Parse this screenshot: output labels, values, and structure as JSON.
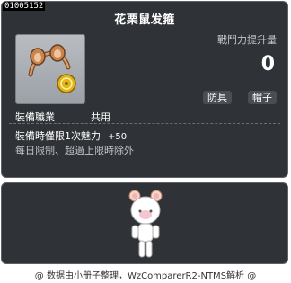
{
  "item": {
    "id": "01005152",
    "name": "花栗鼠发箍"
  },
  "stats": {
    "label": "戰鬥力提升量",
    "value": "0"
  },
  "tags": {
    "type": "防具",
    "subtype": "帽子"
  },
  "job": {
    "label": "裝備職業",
    "value": "共用"
  },
  "effects": {
    "line": "裝備時僅限1次魅力",
    "bonus": "+50",
    "limit": "每日限制、超過上限時除外"
  },
  "footer": {
    "text": "@ 数据由小册子整理，WzComparerR2-NTMS解析 @"
  },
  "colors": {
    "panel": "#2f3236",
    "border": "#5e6268",
    "icon_bg": "#b9bdc2"
  },
  "icons": {
    "item": "chipmunk-headband-icon",
    "character": "character-preview-icon"
  }
}
